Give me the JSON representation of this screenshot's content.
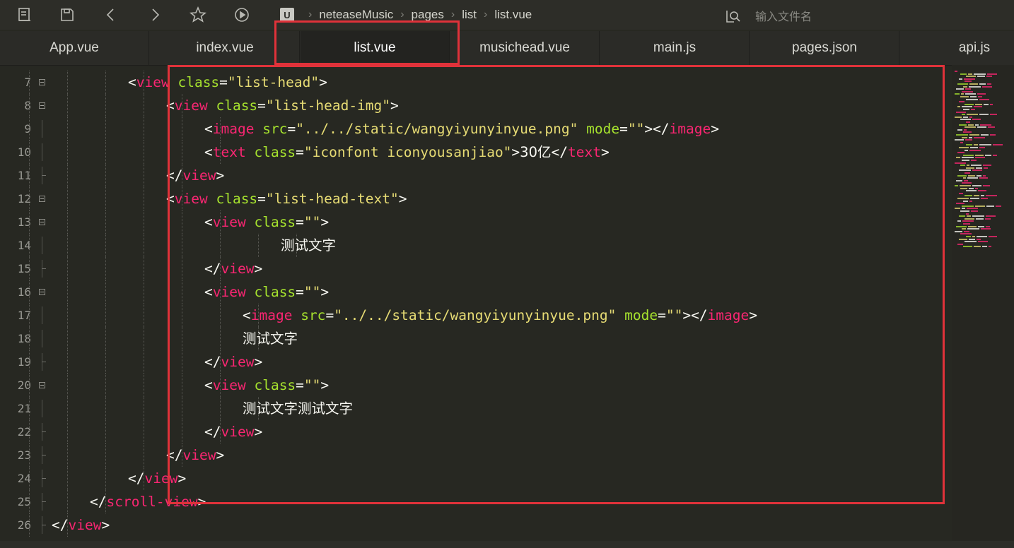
{
  "toolbar": {
    "buttons": [
      {
        "name": "new-file-icon"
      },
      {
        "name": "save-icon"
      },
      {
        "name": "back-arrow-icon"
      },
      {
        "name": "forward-arrow-icon"
      },
      {
        "name": "star-icon"
      },
      {
        "name": "run-icon"
      }
    ]
  },
  "breadcrumb": {
    "logo": "U",
    "items": [
      "neteaseMusic",
      "pages",
      "list",
      "list.vue"
    ]
  },
  "search": {
    "placeholder": "输入文件名"
  },
  "tabs": [
    {
      "label": "App.vue",
      "active": false
    },
    {
      "label": "index.vue",
      "active": false
    },
    {
      "label": "list.vue",
      "active": true
    },
    {
      "label": "musichead.vue",
      "active": false
    },
    {
      "label": "main.js",
      "active": false
    },
    {
      "label": "pages.json",
      "active": false
    },
    {
      "label": "api.js",
      "active": false
    }
  ],
  "code": {
    "lines": [
      {
        "n": "7",
        "text": "<view class=\"list-head\">"
      },
      {
        "n": "8",
        "text": "<view class=\"list-head-img\">"
      },
      {
        "n": "9",
        "text": "<image src=\"../../static/wangyiyunyinyue.png\" mode=\"\"></image>"
      },
      {
        "n": "10",
        "text": "<text class=\"iconfont iconyousanjiao\">30亿</text>"
      },
      {
        "n": "11",
        "text": "</view>"
      },
      {
        "n": "12",
        "text": "<view class=\"list-head-text\">"
      },
      {
        "n": "13",
        "text": "<view class=\"\">"
      },
      {
        "n": "14",
        "text": "测试文字"
      },
      {
        "n": "15",
        "text": "</view>"
      },
      {
        "n": "16",
        "text": "<view class=\"\">"
      },
      {
        "n": "17",
        "text": "<image src=\"../../static/wangyiyunyinyue.png\" mode=\"\"></image>"
      },
      {
        "n": "18",
        "text": "测试文字"
      },
      {
        "n": "19",
        "text": "</view>"
      },
      {
        "n": "20",
        "text": "<view class=\"\">"
      },
      {
        "n": "21",
        "text": "测试文字测试文字"
      },
      {
        "n": "22",
        "text": "</view>"
      },
      {
        "n": "23",
        "text": "</view>"
      },
      {
        "n": "24",
        "text": "</view>"
      },
      {
        "n": "25",
        "text": "</scroll-view>"
      },
      {
        "n": "26",
        "text": "</view>"
      }
    ]
  },
  "colors": {
    "tag": "#f92672",
    "attribute": "#a6e22e",
    "string": "#e6db74",
    "text": "#f8f8f2",
    "highlight": "#e0323a"
  }
}
